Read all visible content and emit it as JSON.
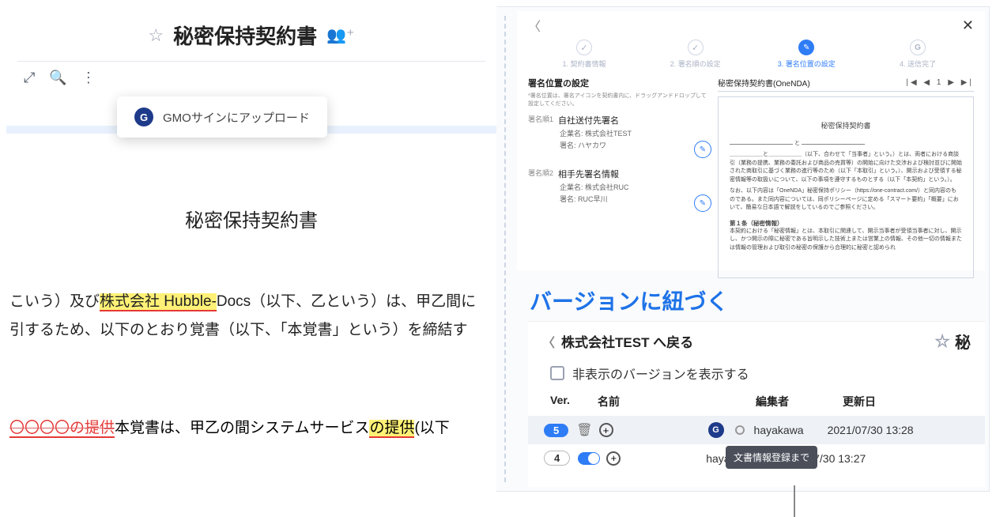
{
  "left_doc": {
    "title": "秘密保持契約書",
    "menu_item": "GMOサインにアップロード",
    "body_title": "秘密保持契約書",
    "para_prefix": "こいう）及び",
    "highlight1": "株式会社 Hubble-",
    "para_mid1": "Docs（以下、乙という）は、甲乙間に",
    "para_line2a": "引するため、以下のとおり覚書（以下、「本覚書」という）を締結す",
    "redline_strike": "〇〇〇〇の提供",
    "redline_mid": "本覚書は、甲乙の間システムサービス",
    "redline_hl": "の提供",
    "redline_tail": "(以下"
  },
  "wizard": {
    "steps": [
      "1. 契約書情報",
      "2. 署名順の設定",
      "3. 署名位置の設定",
      "4. 送信完了"
    ],
    "section_title": "署名位置の設定",
    "section_note": "*署名位置は、署名アイコンを契約書内に、ドラッグアンドドロップして設定してください。",
    "s1": {
      "ord": "署名順1",
      "name": "自社送付先署名",
      "company_label": "企業名:",
      "company": "株式会社TEST",
      "signer_label": "署名:",
      "signer": "ハヤカワ"
    },
    "s2": {
      "ord": "署名順2",
      "name": "相手先署名情報",
      "company_label": "企業名:",
      "company": "株式会社RUC",
      "signer_label": "署名:",
      "signer": "RUC早川"
    },
    "preview_title": "秘密保持契約書(OneNDA)",
    "pager": "|◀  ◀ 1 ▶  ▶|",
    "pv_doc_title": "秘密保持契約書",
    "pv_para": "＿＿＿＿＿＿と＿＿＿＿＿＿（以下、合わせて「当事者」という。）とは、両者における商談引（業務の提携、業務の委託および商品の売買等）の開始に向けた交渉および検討並びに開始された商取引に基づく業務の進行等のため（以下「本取引」という。）、開示および受領する秘密情報等の取扱いについて、以下の事項を遵守するものとする（以下「本契約」という。）。",
    "pv_para2": "なお、以下内容は「OneNDA」秘密保持ポリシー（https://one-contract.com/）と同内容のものである。また同内容については、同ポリシーページに定める「スマート要約」「概要」において、簡易な日本語で解説をしているのでご参照ください。",
    "pv_art_title": "第１条（秘密情報）",
    "pv_art_body": "本契約における「秘密情報」とは、本取引に関連して、開示当事者が受領当事者に対し、開示し、かつ開示の際に秘密である旨明示した技術上または営業上の情報、その他一切の情報または情報の管理および取引の秘密の保護から合理的に秘密と認められ"
  },
  "caption": "バージョンに紐づく",
  "versions": {
    "back": "株式会社TEST  へ戻る",
    "right_title": "秘",
    "checkbox_label": "非表示のバージョンを表示する",
    "cols": {
      "ver": "Ver.",
      "name": "名前",
      "editor": "編集者",
      "date": "更新日"
    },
    "rows": [
      {
        "ver": "5",
        "editor": "hayakawa",
        "date": "2021/07/30 13:28"
      },
      {
        "ver": "4",
        "editor": "hayakawa",
        "date": "2021/07/30 13:27",
        "tooltip": "文書情報登録まで"
      }
    ]
  }
}
